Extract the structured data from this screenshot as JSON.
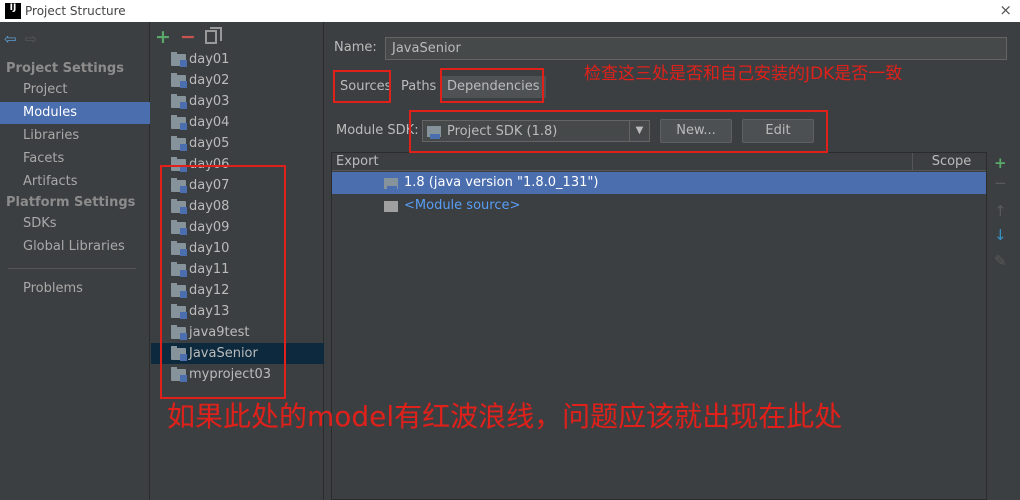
{
  "window": {
    "icon_text": "IJ",
    "title": "Project Structure",
    "close": "×"
  },
  "leftnav": {
    "project_settings_header": "Project Settings",
    "project_items": [
      "Project",
      "Modules",
      "Libraries",
      "Facets",
      "Artifacts"
    ],
    "selected": "Modules",
    "platform_settings_header": "Platform Settings",
    "platform_items": [
      "SDKs",
      "Global Libraries"
    ],
    "problems": "Problems"
  },
  "modules": {
    "items": [
      "day01",
      "day02",
      "day03",
      "day04",
      "day05",
      "day06",
      "day07",
      "day08",
      "day09",
      "day10",
      "day11",
      "day12",
      "day13",
      "java9test",
      "JavaSenior",
      "myproject03"
    ],
    "selected": "JavaSenior"
  },
  "detail": {
    "name_label": "Name:",
    "name_value": "JavaSenior",
    "tabs": [
      "Sources",
      "Paths",
      "Dependencies"
    ],
    "selected_tab": "Dependencies",
    "module_sdk_label": "Module SDK:",
    "module_sdk_value": "Project SDK (1.8)",
    "new_button": "New...",
    "edit_button": "Edit",
    "table_headers": {
      "export": "Export",
      "scope": "Scope"
    },
    "rows": [
      "1.8 (java version \"1.8.0_131\")",
      "<Module source>"
    ]
  },
  "annotations": {
    "top": "检查这三处是否和自己安装的JDK是否一致",
    "bottom": "如果此处的model有红波浪线，问题应该就出现在此处",
    "color": "#e0201a"
  },
  "colors": {
    "selection": "#4b6eaf",
    "background": "#3c3f41"
  }
}
